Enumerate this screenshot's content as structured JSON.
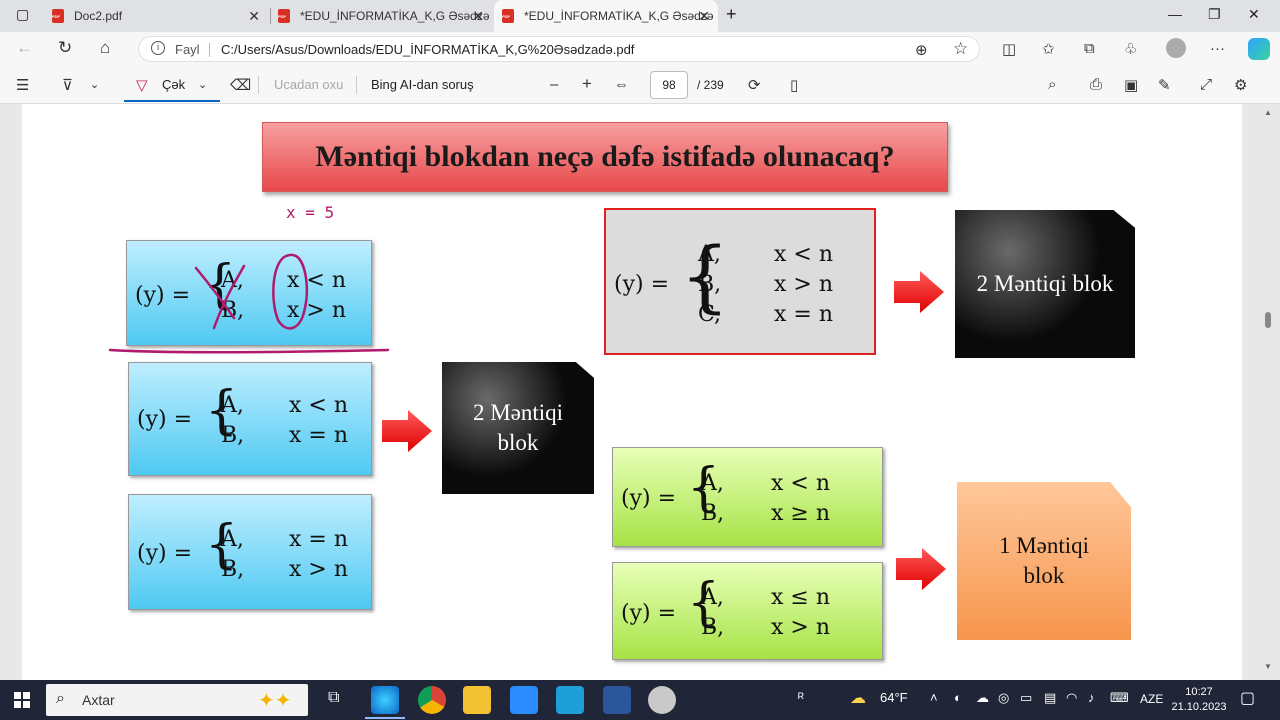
{
  "browser": {
    "tabs": [
      {
        "label": "Doc2.pdf",
        "active": false
      },
      {
        "label": "*EDU_İNFORMATİKA_K,G Əsədzə",
        "active": false
      },
      {
        "label": "*EDU_İNFORMATİKA_K,G Əsədzə",
        "active": true
      }
    ],
    "new_tab": "+",
    "address": {
      "scheme_label": "Fayl",
      "url": "C:/Users/Asus/Downloads/EDU_İNFORMATİKA_K,G%20Əsədzadə.pdf"
    }
  },
  "pdf_toolbar": {
    "draw_label": "Çək",
    "read_aloud_label": "Ucadan oxu",
    "ask_bing_label": "Bing AI-dan soruş",
    "page_current": "98",
    "page_total": "/ 239",
    "zoom_out": "–",
    "zoom_in": "+"
  },
  "slide": {
    "title": "Məntiqi blokdan neçə dəfə istifadə olunacaq?",
    "annotation_text": "x = 5",
    "blue_equations": [
      {
        "lhs": "(y) =",
        "rows": [
          {
            "val": "A,",
            "cond": "x < n"
          },
          {
            "val": "B,",
            "cond": "x > n"
          }
        ]
      },
      {
        "lhs": "(y) =",
        "rows": [
          {
            "val": "A,",
            "cond": "x < n"
          },
          {
            "val": "B,",
            "cond": "x = n"
          }
        ]
      },
      {
        "lhs": "(y) =",
        "rows": [
          {
            "val": "A,",
            "cond": "x = n"
          },
          {
            "val": "B,",
            "cond": "x > n"
          }
        ]
      }
    ],
    "gray_equation": {
      "lhs": "(y) =",
      "rows": [
        {
          "val": "A,",
          "cond": "x < n"
        },
        {
          "val": "B,",
          "cond": "x > n"
        },
        {
          "val": "C,",
          "cond": "x = n"
        }
      ]
    },
    "green_equations": [
      {
        "lhs": "(y) =",
        "rows": [
          {
            "val": "A,",
            "cond": "x < n"
          },
          {
            "val": "B,",
            "cond": "x ≥ n"
          }
        ]
      },
      {
        "lhs": "(y) =",
        "rows": [
          {
            "val": "A,",
            "cond": "x ≤ n"
          },
          {
            "val": "B,",
            "cond": "x > n"
          }
        ]
      }
    ],
    "results": {
      "left_black_line1": "2 Məntiqi",
      "left_black_line2": "blok",
      "right_black": "2 Məntiqi blok",
      "orange_line1": "1  Məntiqi",
      "orange_line2": "blok"
    },
    "colors": {
      "title_red": "#e8484a",
      "blue": "#4fc9f2",
      "green": "#a6e346",
      "orange": "#f7954c",
      "arrow_red": "#ff1010",
      "ink_magenta": "#b01a6c"
    }
  },
  "taskbar": {
    "search_placeholder": "Axtar",
    "weather": "64°F",
    "language": "AZE",
    "time": "10:27",
    "date": "21.10.2023"
  }
}
